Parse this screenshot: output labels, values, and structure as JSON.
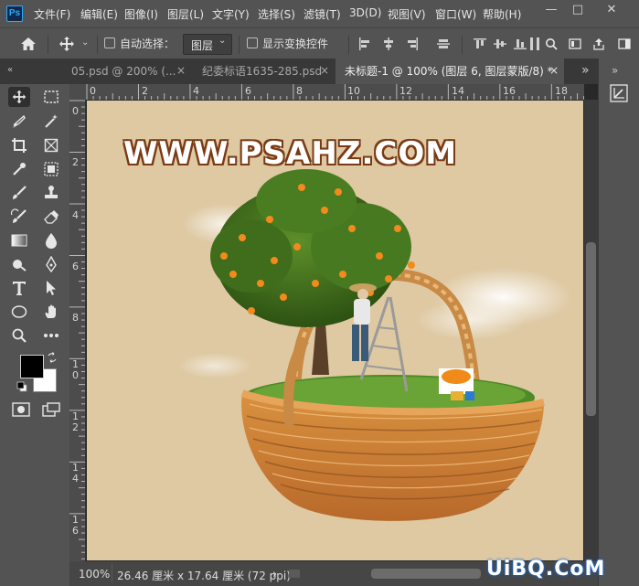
{
  "app": {
    "logo": "Ps"
  },
  "menu": [
    "文件(F)",
    "编辑(E)",
    "图像(I)",
    "图层(L)",
    "文字(Y)",
    "选择(S)",
    "滤镜(T)",
    "3D(D)",
    "视图(V)",
    "窗口(W)",
    "帮助(H)"
  ],
  "window_controls": {
    "minimize": "—",
    "maximize": "□",
    "close": "✕"
  },
  "options_bar": {
    "auto_select_label": "自动选择：",
    "layer_select_value": "图层",
    "show_transform_label": "显示变换控件"
  },
  "tabs": [
    {
      "label": "05.psd @ 200% (...",
      "active": false
    },
    {
      "label": "纪委标语1635-285.psd",
      "active": false
    },
    {
      "label": "未标题-1 @ 100% (图层 6, 图层蒙版/8) *",
      "active": true
    }
  ],
  "tab_close_glyph": "×",
  "tab_overflow": "»",
  "ruler": {
    "horizontal": [
      "0",
      "2",
      "4",
      "6",
      "8",
      "10",
      "12",
      "14",
      "16",
      "18"
    ],
    "vertical": [
      "0",
      "2",
      "4",
      "6",
      "8",
      "1\n0",
      "1\n2",
      "1\n4",
      "1\n6"
    ]
  },
  "canvas": {
    "headline": "WWW.PSAHZ.COM",
    "background_color": "#dec9a3",
    "headline_color": "#ffffff",
    "headline_outline": "#7a3a14"
  },
  "status": {
    "zoom": "100%",
    "doc_size": "26.46 厘米 x 17.64 厘米 (72 ppi)",
    "arrow": "›"
  },
  "watermark": "UiBQ.CoM",
  "icons": {
    "move": "move-icon",
    "marquee": "rect-marquee-icon",
    "lasso": "lasso-icon",
    "wand": "magic-wand-icon",
    "crop": "crop-icon",
    "frame": "frame-icon",
    "eyedropper": "eyedropper-icon",
    "patch": "healing-icon",
    "brush": "brush-icon",
    "stamp": "clone-stamp-icon",
    "history": "history-brush-icon",
    "eraser": "eraser-icon",
    "gradient": "gradient-icon",
    "blur": "blur-icon",
    "dodge": "dodge-icon",
    "pen": "pen-icon",
    "type": "type-icon",
    "path": "path-select-icon",
    "ellipse": "ellipse-icon",
    "hand": "hand-icon",
    "zoom": "zoom-icon",
    "more": "more-icon"
  }
}
